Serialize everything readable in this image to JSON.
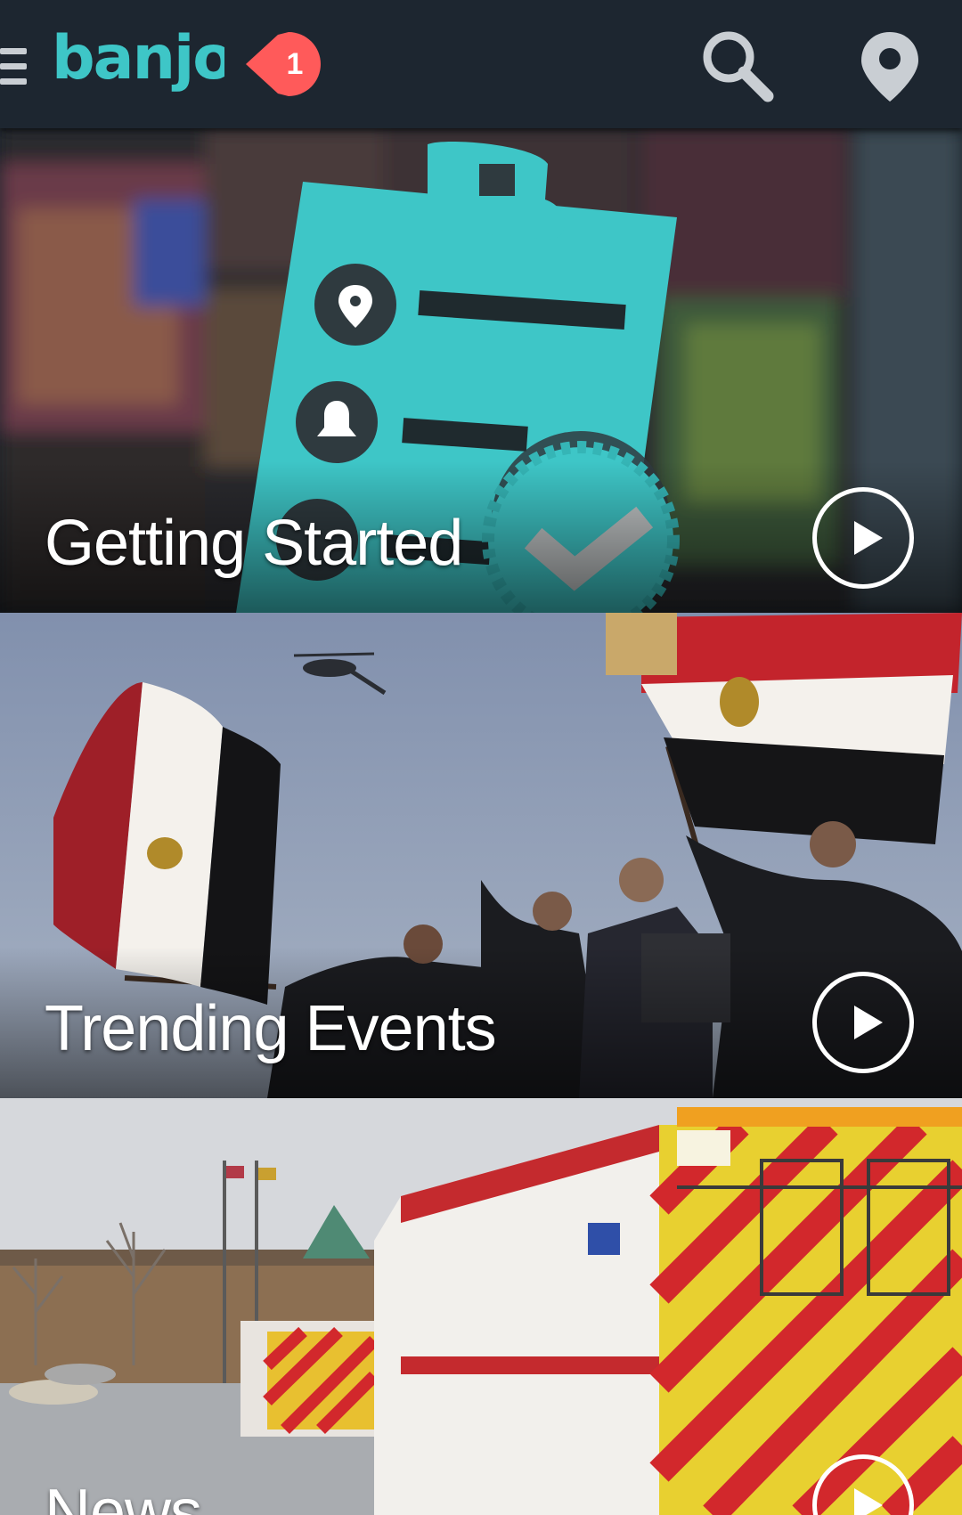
{
  "app": {
    "brand_name": "banjo",
    "notification_count": "1"
  },
  "colors": {
    "topbar_bg": "#1d2630",
    "brand_teal": "#3ec6c7",
    "notification_red": "#ff5a5a",
    "icon_gray": "#c9ced3"
  },
  "icons": {
    "menu": "hamburger-menu-icon",
    "search": "magnifier-search-icon",
    "location": "map-pin-icon",
    "play": "play-circle-icon"
  },
  "feed": {
    "cards": [
      {
        "title": "Getting Started",
        "image": "teal clipboard illustration with location pin, bell and check badge over blurred photo grid"
      },
      {
        "title": "Trending Events",
        "image": "people waving Egyptian flags under a helicopter"
      },
      {
        "title": "News",
        "image": "Howard County Fire & Rescue ambulances in a parking lot"
      }
    ]
  }
}
